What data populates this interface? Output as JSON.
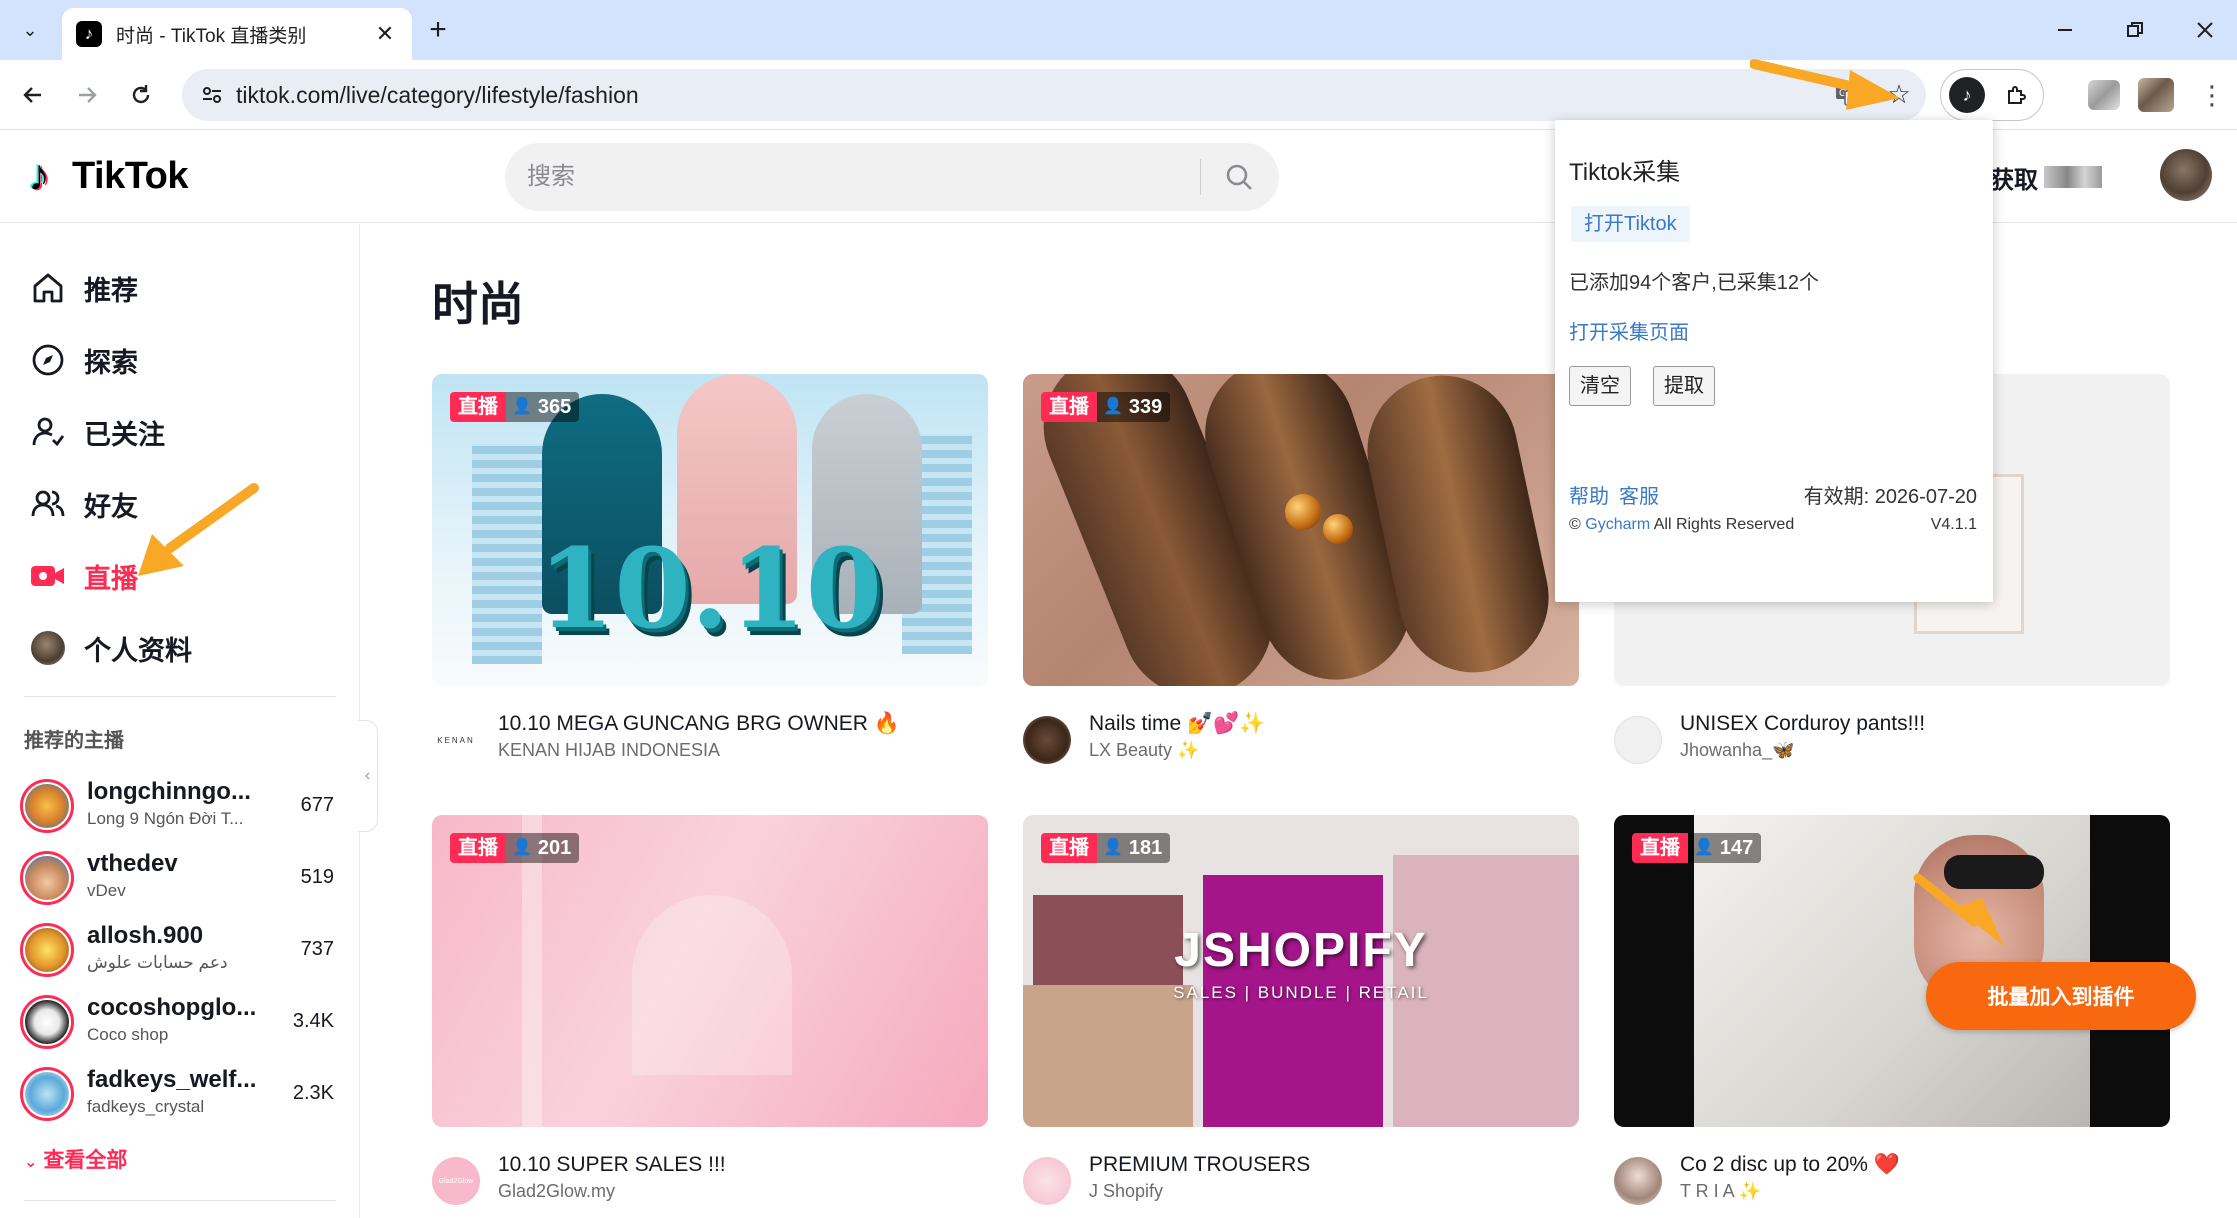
{
  "browser": {
    "tab_title": "时尚 - TikTok 直播类别",
    "url": "tiktok.com/live/category/lifestyle/fashion",
    "new_tab_symbol": "+",
    "close_tab_symbol": "✕"
  },
  "header": {
    "logo_text": "TikTok",
    "search_placeholder": "搜索",
    "get_label": "获取"
  },
  "sidebar": {
    "nav": [
      {
        "label": "推荐",
        "icon": "home-icon"
      },
      {
        "label": "探索",
        "icon": "compass-icon"
      },
      {
        "label": "已关注",
        "icon": "following-icon"
      },
      {
        "label": "好友",
        "icon": "friends-icon"
      },
      {
        "label": "直播",
        "icon": "live-icon",
        "active": true
      },
      {
        "label": "个人资料",
        "icon": "profile-avatar"
      }
    ],
    "recommended_title": "推荐的主播",
    "streamers": [
      {
        "name": "longchinngo...",
        "sub": "Long 9 Ngón Đời T...",
        "count": "677"
      },
      {
        "name": "vthedev",
        "sub": "vDev",
        "count": "519"
      },
      {
        "name": "allosh.900",
        "sub": "دعم حسابات علوش",
        "count": "737"
      },
      {
        "name": "cocoshopglo...",
        "sub": "Coco shop",
        "count": "3.4K"
      },
      {
        "name": "fadkeys_welf...",
        "sub": "fadkeys_crystal",
        "count": "2.3K"
      }
    ],
    "see_all": "查看全部"
  },
  "main": {
    "page_title": "时尚",
    "live_label": "直播",
    "cards": [
      {
        "viewers": "365",
        "title": "10.10 MEGA GUNCANG BRG OWNER 🔥",
        "sub": "KENAN HIJAB INDONESIA",
        "thumb_text": "10.10",
        "avatar_text": "KENAN"
      },
      {
        "viewers": "339",
        "title": "Nails time 💅💕✨",
        "sub": "LX Beauty ✨",
        "thumb_text": "",
        "avatar_text": ""
      },
      {
        "viewers": "",
        "title": "UNISEX Corduroy pants!!!",
        "sub": "Jhowanha_🦋",
        "thumb_text": "",
        "avatar_text": ""
      },
      {
        "viewers": "201",
        "title": "10.10 SUPER SALES !!!",
        "sub": "Glad2Glow.my",
        "thumb_text": "",
        "avatar_text": "Glad2Glow"
      },
      {
        "viewers": "181",
        "title": "PREMIUM TROUSERS",
        "sub": "J Shopify",
        "thumb_text": "JSHOPIFY",
        "thumb_sub": "SALES | BUNDLE | RETAIL",
        "avatar_text": ""
      },
      {
        "viewers": "147",
        "title": "Co 2 disc up to 20% ❤️",
        "sub": "T R I A ✨",
        "thumb_text": "",
        "avatar_text": ""
      }
    ]
  },
  "popup": {
    "title": "Tiktok采集",
    "open_tiktok": "打开Tiktok",
    "status": "已添加94个客户,已采集12个",
    "open_collect_page": "打开采集页面",
    "clear": "清空",
    "extract": "提取",
    "help": "帮助",
    "support": "客服",
    "valid_until": "有效期: 2026-07-20",
    "copyright_prefix": "©",
    "copyright_brand": "Gycharm",
    "copyright_rest": "All Rights Reserved",
    "version": "V4.1.1"
  },
  "batch_button": "批量加入到插件",
  "colors": {
    "accent": "#fe2c55",
    "arrow": "#f9a825",
    "batch": "#f7680f",
    "link": "#3a79c8"
  }
}
